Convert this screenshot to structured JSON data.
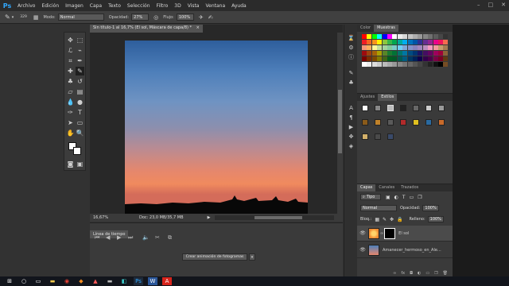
{
  "menubar": {
    "logo": "Ps",
    "items": [
      "Archivo",
      "Edición",
      "Imagen",
      "Capa",
      "Texto",
      "Selección",
      "Filtro",
      "3D",
      "Vista",
      "Ventana",
      "Ayuda"
    ]
  },
  "options": {
    "size": "329",
    "mode_label": "Modo:",
    "mode_value": "Normal",
    "opacity_label": "Opacidad:",
    "opacity_value": "27%",
    "flow_label": "Flujo:",
    "flow_value": "100%"
  },
  "document": {
    "tab_title": "Sin título-1 al 16,7% (El sol, Máscara de capa/8) *",
    "zoom": "16,67%",
    "doc_size": "Doc: 23,0 MB/35,7 MB"
  },
  "timeline": {
    "tab": "Línea de tiempo",
    "create_button": "Crear animación de fotogramas"
  },
  "color_panel": {
    "tabs": [
      "Color",
      "Muestras"
    ],
    "swatch_colors": [
      [
        "#ff0000",
        "#ffff00",
        "#00ff00",
        "#00ffff",
        "#0000ff",
        "#ff00ff",
        "#ffffff",
        "#ebebeb",
        "#d6d6d6",
        "#c2c2c2",
        "#adadad",
        "#999999",
        "#858585",
        "#707070",
        "#5c5c5c",
        "#474747",
        "#333333"
      ],
      [
        "#ee1d24",
        "#f26522",
        "#f7941d",
        "#fff200",
        "#8dc63f",
        "#39b54a",
        "#00a651",
        "#00a99d",
        "#00aeef",
        "#0072bc",
        "#0054a6",
        "#2e3192",
        "#662d91",
        "#92278f",
        "#ec008c",
        "#ed145b",
        "#f26c4f"
      ],
      [
        "#f69679",
        "#fbaf5d",
        "#fff799",
        "#c4df9b",
        "#a3d39c",
        "#82ca9c",
        "#7accc8",
        "#6dcff6",
        "#7da7d9",
        "#8393ca",
        "#8781bd",
        "#a186be",
        "#bd8cbf",
        "#f49ac1",
        "#f5989d",
        "#c69c6d",
        "#a67c52"
      ],
      [
        "#9e0b0f",
        "#a0410d",
        "#a36209",
        "#aba000",
        "#598527",
        "#1a7b30",
        "#007236",
        "#00746b",
        "#0076a3",
        "#004b80",
        "#003471",
        "#1b1464",
        "#440e62",
        "#630460",
        "#9e005d",
        "#9e0039",
        "#8c6239"
      ],
      [
        "#790000",
        "#7b2e00",
        "#7d4900",
        "#827b00",
        "#406618",
        "#005e20",
        "#005826",
        "#005952",
        "#005b7f",
        "#003663",
        "#002157",
        "#0d004c",
        "#32004b",
        "#4b0049",
        "#7b0046",
        "#7a0026",
        "#603913"
      ],
      [
        "#ffffff",
        "#eeeeee",
        "#dddddd",
        "#cccccc",
        "#bbbbbb",
        "#aaaaaa",
        "#999999",
        "#888888",
        "#777777",
        "#666666",
        "#555555",
        "#444444",
        "#333333",
        "#222222",
        "#111111",
        "#000000",
        "#754c24"
      ]
    ]
  },
  "adjust_panel": {
    "tabs": [
      "Ajustes",
      "Estilos"
    ]
  },
  "layers_panel": {
    "tabs": [
      "Capas",
      "Canales",
      "Trazados"
    ],
    "kind_label": "Tipo",
    "blend": "Normal",
    "opacity_label": "Opacidad:",
    "opacity_value": "100%",
    "lock_label": "Bloq.:",
    "fill_label": "Relleno:",
    "fill_value": "100%",
    "layers": [
      {
        "name": "El sol"
      },
      {
        "name": "Amanecer_hermoso_en_Ale..."
      }
    ]
  },
  "taskbar": {
    "icons": [
      "windows-icon",
      "search-icon",
      "taskview-icon",
      "folder-icon",
      "chrome-icon",
      "media-icon",
      "store-icon",
      "app-icon",
      "app2-icon",
      "photoshop-icon",
      "word-icon",
      "acrobat-icon"
    ]
  }
}
